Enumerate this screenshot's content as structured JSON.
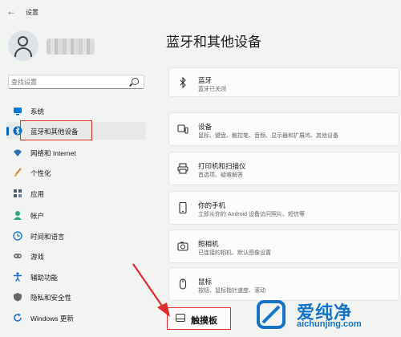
{
  "window": {
    "title": "设置",
    "back_icon": "back-arrow-icon"
  },
  "profile": {
    "name_hidden": true
  },
  "search": {
    "placeholder": "查找设置"
  },
  "sidebar": {
    "items": [
      {
        "label": "系统",
        "icon": "system-icon",
        "color": "#0078d4"
      },
      {
        "label": "蓝牙和其他设备",
        "icon": "bluetooth-icon",
        "color": "#0067c0",
        "selected": true
      },
      {
        "label": "网络和 Internet",
        "icon": "wifi-icon",
        "color": "#2f6db5"
      },
      {
        "label": "个性化",
        "icon": "brush-icon",
        "color": "#d07a2b"
      },
      {
        "label": "应用",
        "icon": "apps-icon",
        "color": "#4a5a70"
      },
      {
        "label": "帐户",
        "icon": "account-icon",
        "color": "#2aa37a"
      },
      {
        "label": "时间和语言",
        "icon": "globe-clock-icon",
        "color": "#2b7bd2"
      },
      {
        "label": "游戏",
        "icon": "game-icon",
        "color": "#777777"
      },
      {
        "label": "辅助功能",
        "icon": "accessibility-icon",
        "color": "#1e6fd0"
      },
      {
        "label": "隐私和安全性",
        "icon": "shield-icon",
        "color": "#666666"
      },
      {
        "label": "Windows 更新",
        "icon": "update-icon",
        "color": "#1e78d6"
      }
    ]
  },
  "main": {
    "title": "蓝牙和其他设备",
    "cards": [
      {
        "title": "蓝牙",
        "subtitle": "蓝牙已关闭",
        "icon": "bluetooth-icon"
      },
      {
        "title": "设备",
        "subtitle": "鼠标、键盘、触控笔、音频、显示器和扩展坞、其他设备",
        "icon": "devices-icon"
      },
      {
        "title": "打印机和扫描仪",
        "subtitle": "首选项、疑难解答",
        "icon": "printer-icon"
      },
      {
        "title": "你的手机",
        "subtitle": "立即从你的 Android 设备访问照片、短信等",
        "icon": "phone-icon"
      },
      {
        "title": "照相机",
        "subtitle": "已连接的相机、默认图像设置",
        "icon": "camera-icon"
      },
      {
        "title": "鼠标",
        "subtitle": "按钮、鼠标指针速度、滚动",
        "icon": "mouse-icon"
      }
    ],
    "touchpad": {
      "title": "触摸板",
      "icon": "touchpad-icon"
    }
  },
  "watermark": {
    "text": "爱纯净",
    "url": "aichunjing.com"
  },
  "annotation_color": "#e12a2a"
}
